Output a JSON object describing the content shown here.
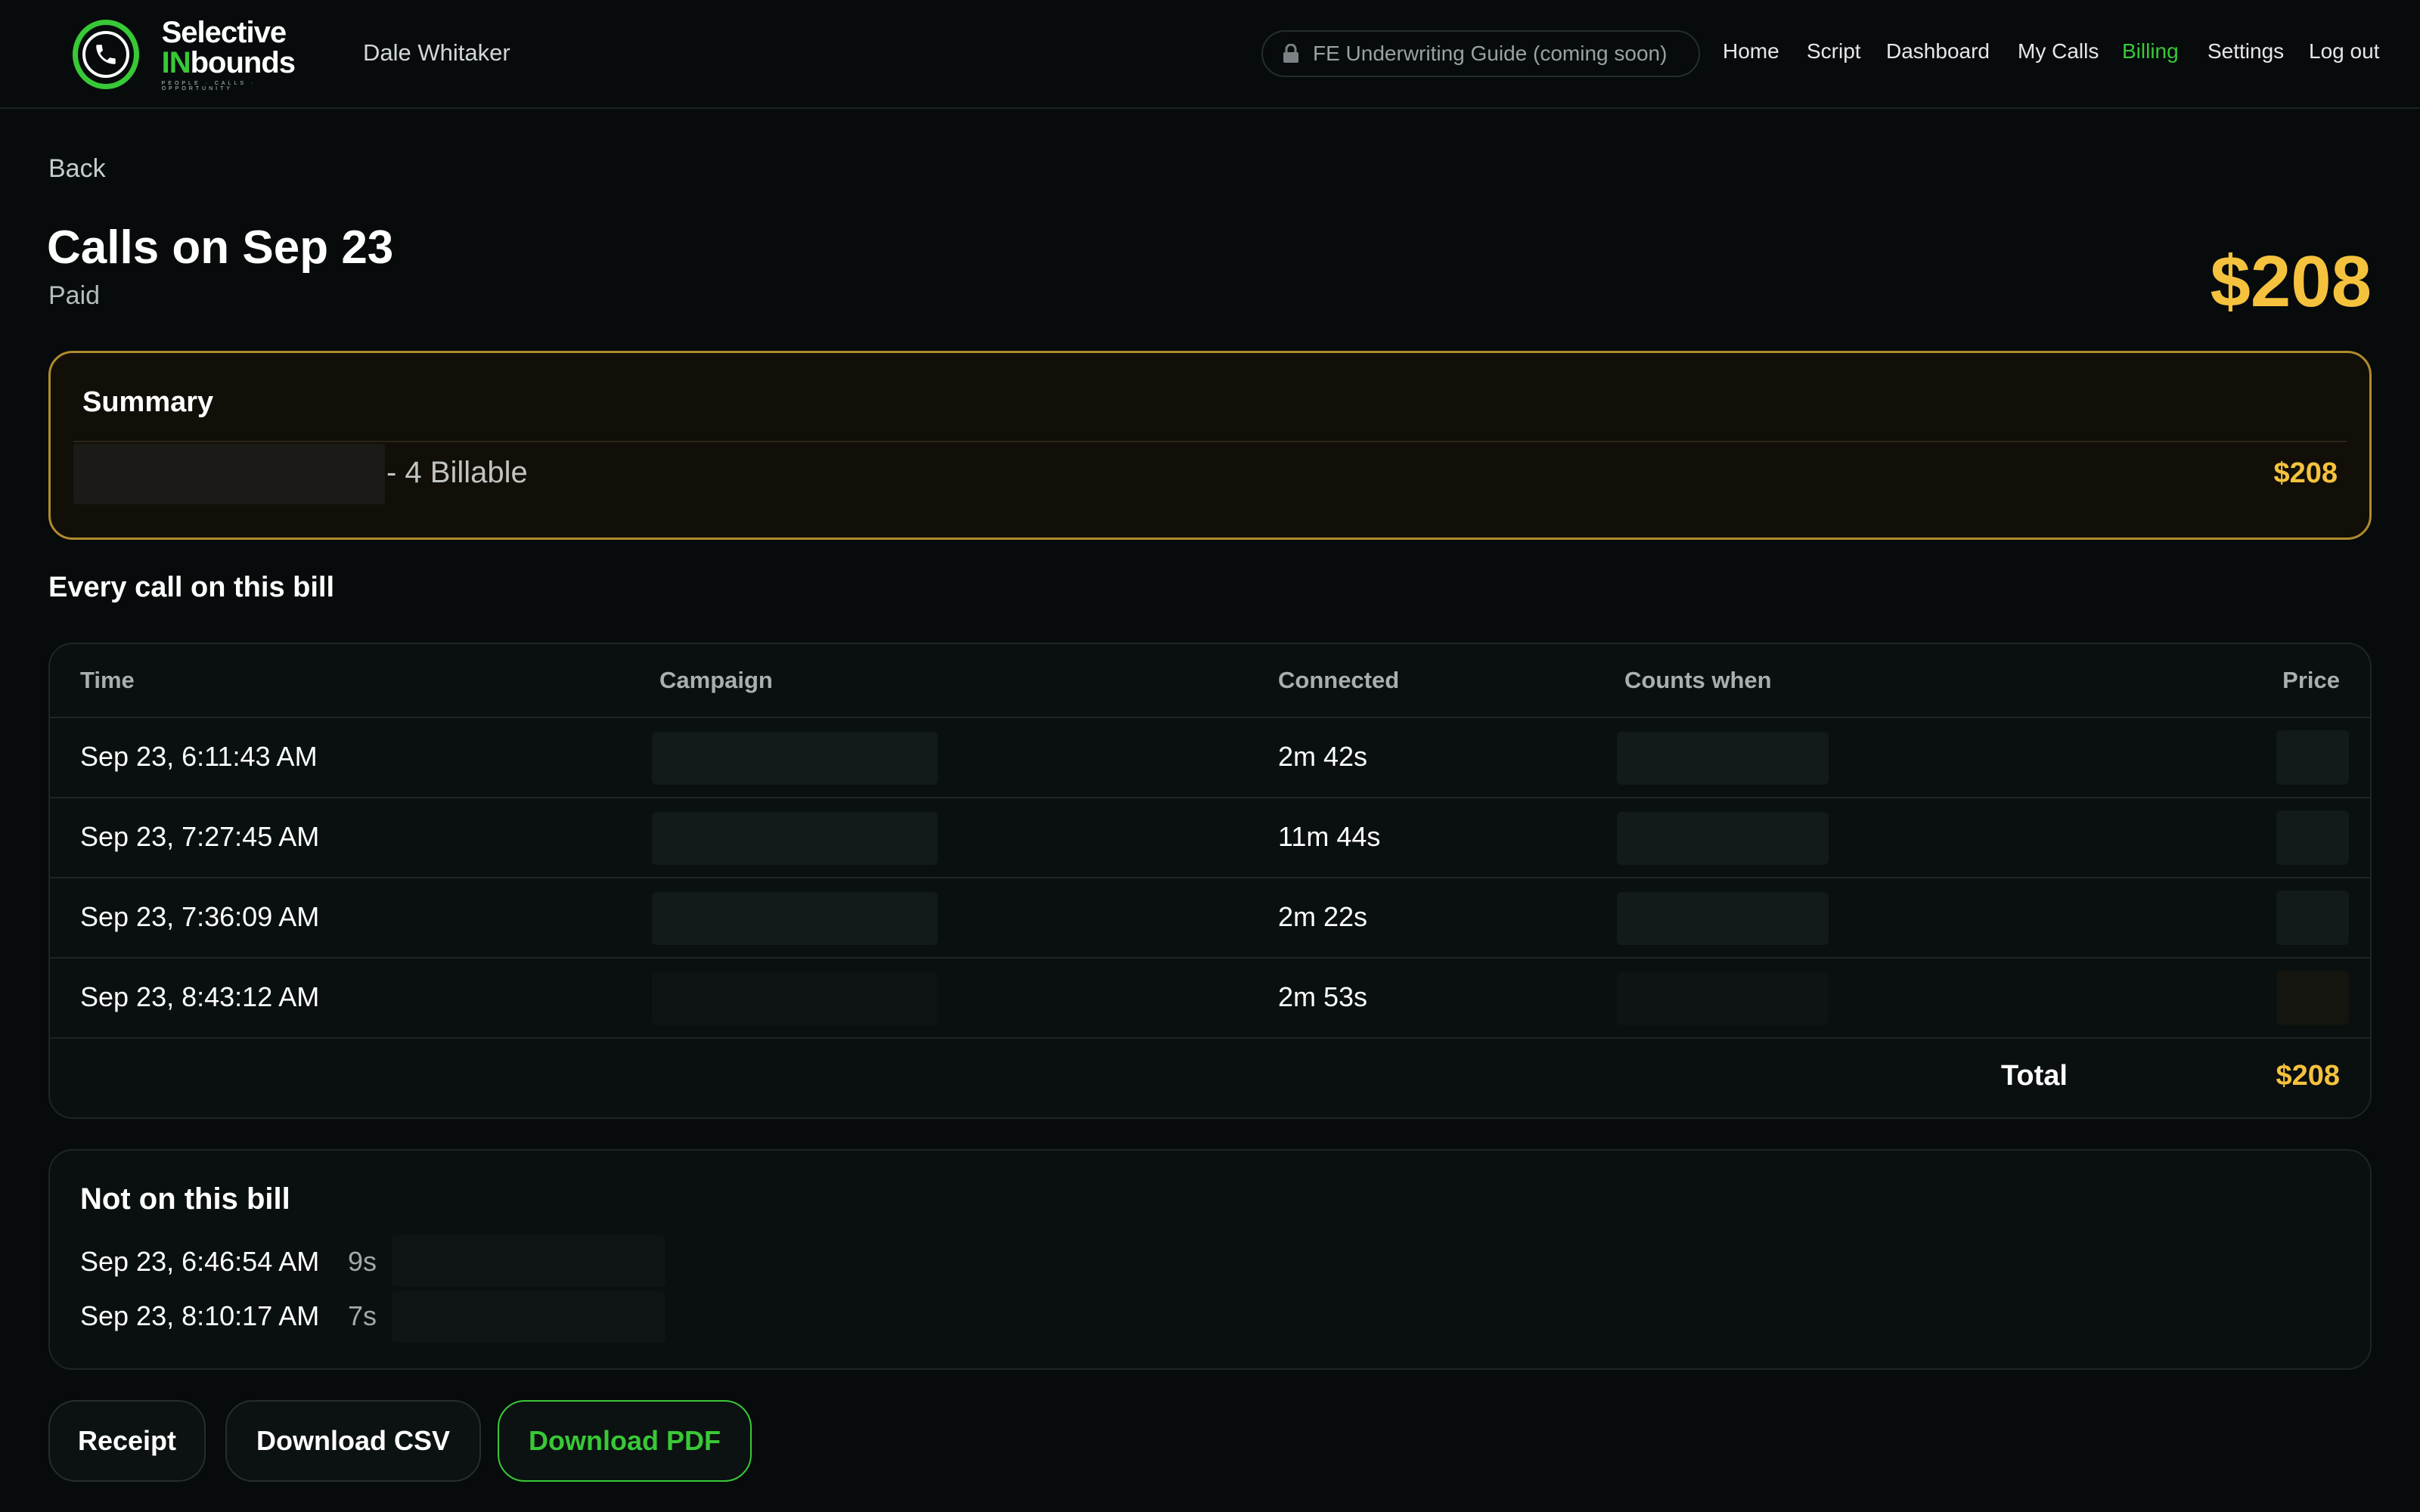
{
  "colors": {
    "accent_green": "#38c936",
    "money_gold": "#f5c23e",
    "background": "#070b0c"
  },
  "header": {
    "logo": {
      "line1": "Selective",
      "line2_prefix": "IN",
      "line2_suffix": "bounds",
      "tagline": "PEOPLE · CALLS · OPPORTUNITY"
    },
    "user_name": "Dale Whitaker",
    "guide_pill": {
      "icon": "lock-icon",
      "label": "FE Underwriting Guide (coming soon)"
    },
    "nav": [
      {
        "label": "Home",
        "active": false
      },
      {
        "label": "Script",
        "active": false
      },
      {
        "label": "Dashboard",
        "active": false
      },
      {
        "label": "My Calls",
        "active": false
      },
      {
        "label": "Billing",
        "active": true
      },
      {
        "label": "Settings",
        "active": false
      },
      {
        "label": "Log out",
        "active": false
      }
    ]
  },
  "page": {
    "back_label": "Back",
    "title": "Calls on Sep 23",
    "status": "Paid",
    "total": "$208"
  },
  "summary": {
    "title": "Summary",
    "billable_text": "- 4 Billable",
    "amount": "$208"
  },
  "calls_section": {
    "title": "Every call on this bill",
    "columns": [
      "Time",
      "Campaign",
      "Connected",
      "Counts when",
      "Price"
    ],
    "rows": [
      {
        "time": "Sep 23, 6:11:43 AM",
        "connected": "2m 42s"
      },
      {
        "time": "Sep 23, 7:27:45 AM",
        "connected": "11m 44s"
      },
      {
        "time": "Sep 23, 7:36:09 AM",
        "connected": "2m 22s"
      },
      {
        "time": "Sep 23, 8:43:12 AM",
        "connected": "2m 53s"
      }
    ],
    "total_label": "Total",
    "total_value": "$208"
  },
  "not_on_bill": {
    "title": "Not on this bill",
    "items": [
      {
        "time": "Sep 23, 6:46:54 AM",
        "duration": "9s"
      },
      {
        "time": "Sep 23, 8:10:17 AM",
        "duration": "7s"
      }
    ]
  },
  "actions": {
    "receipt": "Receipt",
    "download_csv": "Download CSV",
    "download_pdf": "Download PDF"
  }
}
